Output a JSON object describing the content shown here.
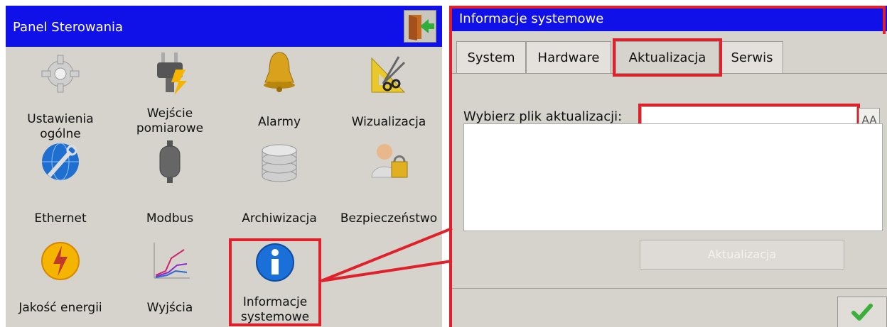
{
  "control_panel": {
    "title": "Panel Sterowania",
    "tiles": [
      {
        "label_line1": "Ustawienia",
        "label_line2": "ogólne",
        "icon": "gear-icon"
      },
      {
        "label_line1": "Wejście",
        "label_line2": "pomiarowe",
        "icon": "plug-icon"
      },
      {
        "label_line1": "Alarmy",
        "label_line2": "",
        "icon": "bell-icon"
      },
      {
        "label_line1": "Wizualizacja",
        "label_line2": "",
        "icon": "ruler-scissors-icon"
      },
      {
        "label_line1": "Ethernet",
        "label_line2": "",
        "icon": "globe-wrench-icon"
      },
      {
        "label_line1": "Modbus",
        "label_line2": "",
        "icon": "cylinder-icon"
      },
      {
        "label_line1": "Archiwizacja",
        "label_line2": "",
        "icon": "database-icon"
      },
      {
        "label_line1": "Bezpieczeństwo",
        "label_line2": "",
        "icon": "user-lock-icon"
      },
      {
        "label_line1": "Jakość energii",
        "label_line2": "",
        "icon": "lightning-icon"
      },
      {
        "label_line1": "Wyjścia",
        "label_line2": "",
        "icon": "line-chart-icon"
      },
      {
        "label_line1": "Informacje",
        "label_line2": "systemowe",
        "icon": "info-icon"
      }
    ]
  },
  "system_info": {
    "title": "Informacje systemowe",
    "tabs": [
      "System",
      "Hardware",
      "Aktualizacja",
      "Serwis"
    ],
    "active_tab": "Aktualizacja",
    "file_label": "Wybierz plik aktualizacji:",
    "file_value": "",
    "keyboard_icon_text": "AA",
    "update_button": "Aktualizacja",
    "ok_icon": "checkmark-icon"
  },
  "colors": {
    "title_bar": "#1010e8",
    "highlight": "#e0202a",
    "panel_bg": "#d6d3cd"
  }
}
